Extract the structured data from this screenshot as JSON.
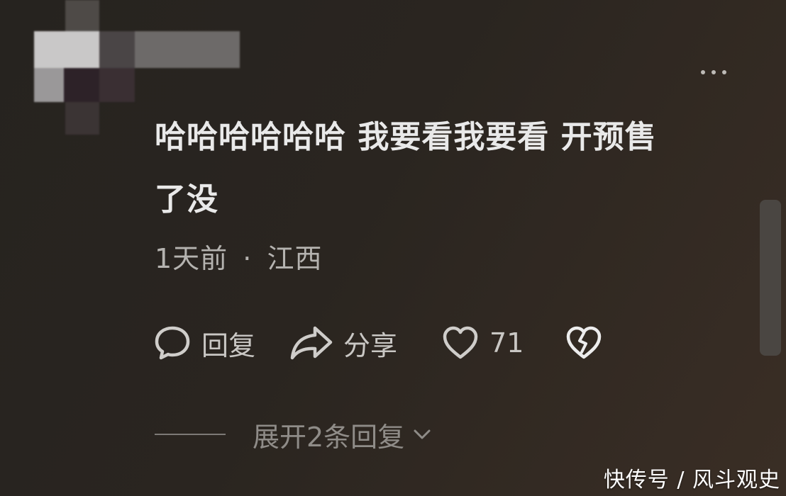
{
  "comment": {
    "text_line1": "哈哈哈哈哈哈 我要看我要看 开预售",
    "text_line2": "了没"
  },
  "meta": {
    "time": "1天前",
    "separator": "·",
    "location": "江西"
  },
  "actions": {
    "reply_label": "回复",
    "share_label": "分享",
    "like_count": "71"
  },
  "expand": {
    "label": "展开2条回复"
  },
  "icons": [
    "more-icon",
    "reply-icon",
    "share-icon",
    "heart-icon",
    "broken-heart-icon",
    "chevron-down-icon"
  ],
  "watermark": "快传号 / 风斗观史",
  "colors": {
    "text_primary": "#e9e9e9",
    "text_secondary": "#b5b3b0",
    "text_muted": "#8f8c88"
  }
}
